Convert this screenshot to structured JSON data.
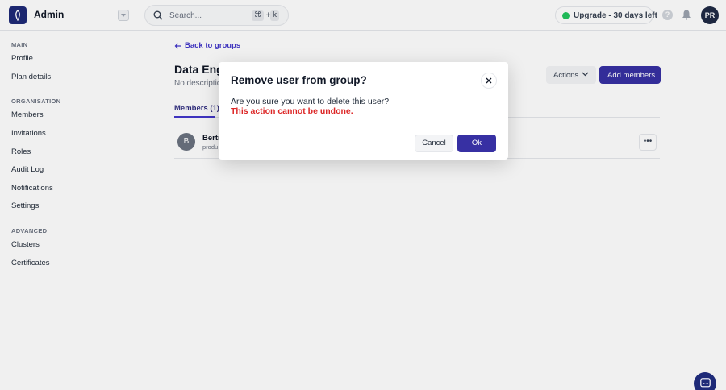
{
  "app": {
    "org_name": "Admin",
    "search_placeholder": "Search...",
    "search_shortcut": [
      "⌘",
      "+",
      "k"
    ],
    "upgrade_label": "Upgrade - 30 days left",
    "help_icon": "question-icon",
    "user_initials": "PR"
  },
  "sidebar": {
    "sections": [
      {
        "heading": "MAIN",
        "items": [
          "Profile",
          "Plan details"
        ]
      },
      {
        "heading": "ORGANISATION",
        "items": [
          "Members",
          "Invitations",
          "Roles",
          "Audit Log",
          "Notifications",
          "Settings"
        ]
      },
      {
        "heading": "ADVANCED",
        "items": [
          "Clusters",
          "Certificates"
        ]
      }
    ]
  },
  "main": {
    "back_label": "Back to groups",
    "title": "Data Engi",
    "description": "No description",
    "actions_label": "Actions",
    "add_members_label": "Add members",
    "tab_members": "Members (1)",
    "member": {
      "initial": "B",
      "name": "Bertr",
      "sub": "produ"
    }
  },
  "modal": {
    "title": "Remove user from group?",
    "body": "Are you sure you want to delete this user?",
    "warning": "This action cannot be undone.",
    "cancel_label": "Cancel",
    "ok_label": "Ok"
  },
  "colors": {
    "primary": "#3730a3",
    "danger": "#dc2626",
    "success": "#22c55e",
    "brand_dark": "#1e2a78"
  }
}
